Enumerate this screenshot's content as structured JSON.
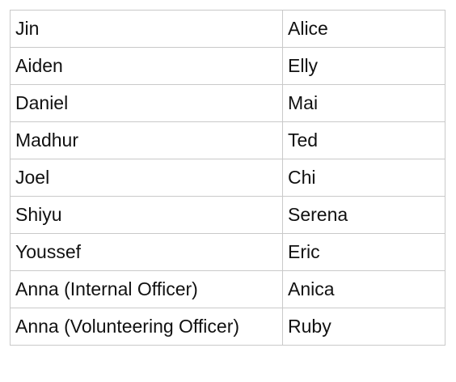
{
  "table": {
    "rows": [
      [
        "Jin",
        "Alice"
      ],
      [
        "Aiden",
        "Elly"
      ],
      [
        "Daniel",
        "Mai"
      ],
      [
        "Madhur",
        "Ted"
      ],
      [
        "Joel",
        "Chi"
      ],
      [
        "Shiyu",
        "Serena"
      ],
      [
        "Youssef",
        "Eric"
      ],
      [
        "Anna (Internal Officer)",
        "Anica"
      ],
      [
        "Anna (Volunteering Officer)",
        "Ruby"
      ]
    ]
  }
}
